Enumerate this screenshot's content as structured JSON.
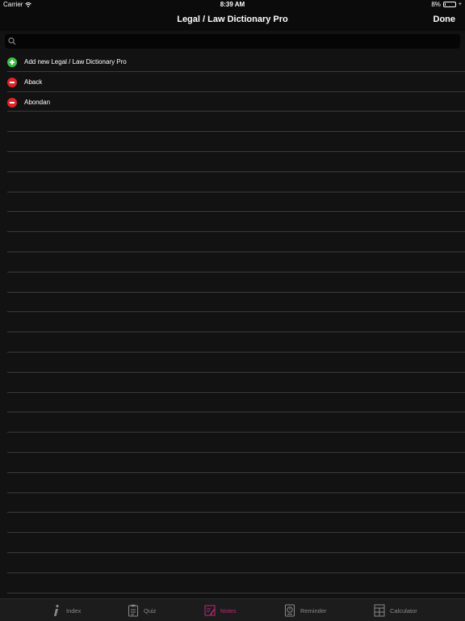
{
  "status_bar": {
    "carrier": "Carrier",
    "time": "8:39 AM",
    "battery": "8%",
    "battery_level": 0.08
  },
  "nav": {
    "title": "Legal / Law Dictionary Pro",
    "done_label": "Done"
  },
  "search": {
    "placeholder": ""
  },
  "list": {
    "items": [
      {
        "label": "Add new Legal / Law Dictionary Pro",
        "kind": "add"
      },
      {
        "label": "Aback",
        "kind": "remove"
      },
      {
        "label": "Abondan",
        "kind": "remove"
      }
    ],
    "empty_rows": 24
  },
  "tabs": [
    {
      "label": "Index",
      "icon": "info-icon",
      "active": false
    },
    {
      "label": "Quiz",
      "icon": "clipboard-icon",
      "active": false
    },
    {
      "label": "Notes",
      "icon": "notes-icon",
      "active": true
    },
    {
      "label": "Reminder",
      "icon": "alarm-icon",
      "active": false
    },
    {
      "label": "Calculator",
      "icon": "calculator-icon",
      "active": false
    }
  ],
  "colors": {
    "add": "#36c23f",
    "remove": "#e0242a",
    "active_tab": "#c0267a",
    "inactive_tab": "#8a8a8a"
  }
}
